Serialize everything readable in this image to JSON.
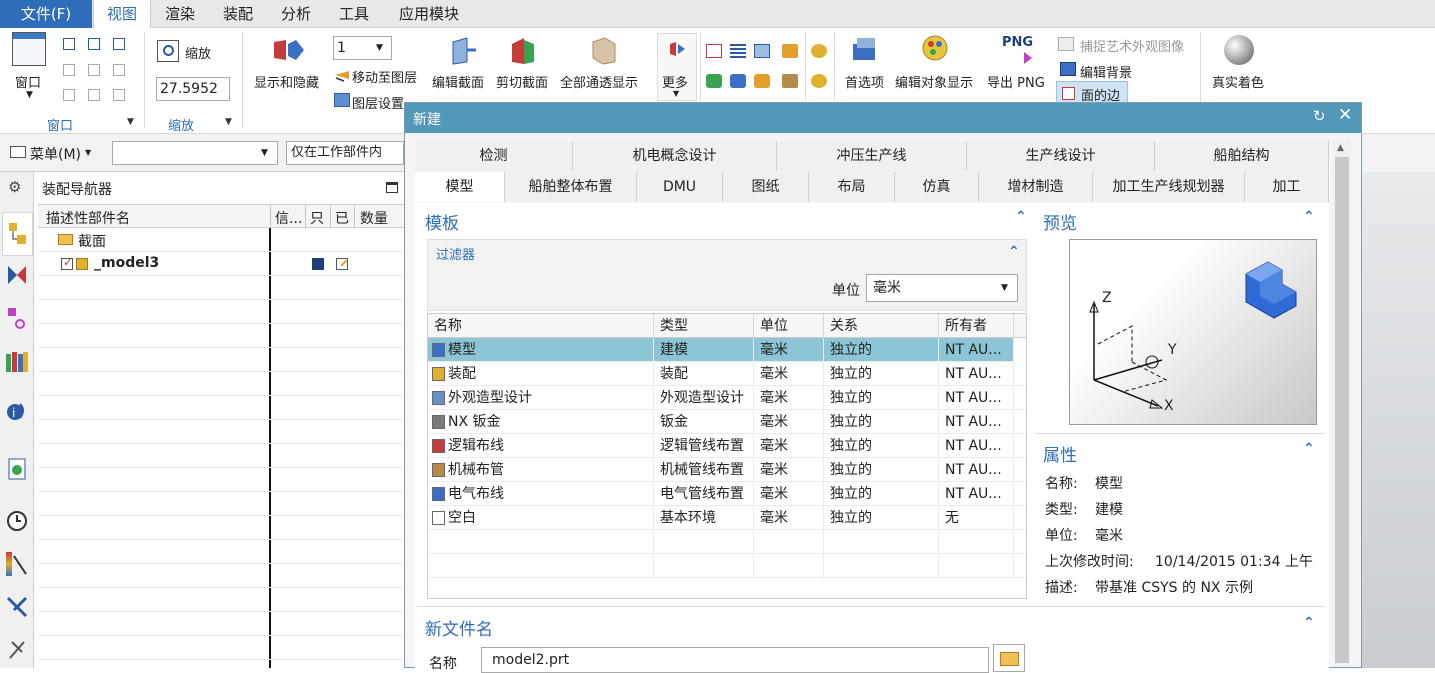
{
  "menubar": {
    "file": "文件(F)",
    "tabs": [
      "视图",
      "渲染",
      "装配",
      "分析",
      "工具",
      "应用模块"
    ],
    "active_tab": "视图"
  },
  "ribbon": {
    "window_label": "窗口",
    "group_window": "窗口",
    "zoom_label": "缩放",
    "zoom_value": "27.5952",
    "group_zoom": "缩放",
    "layer_value": "1",
    "show_hide": "显示和隐藏",
    "move_to_layer": "移动至图层",
    "layer_settings": "图层设置",
    "edit_section": "编辑截面",
    "clip_section": "剪切截面",
    "all_transparent": "全部通透显示",
    "more": "更多",
    "preferences": "首选项",
    "edit_object_display": "编辑对象显示",
    "export_png": "导出 PNG",
    "png_icon_text": "PNG",
    "capture_art": "捕捉艺术外观图像",
    "edit_background": "编辑背景",
    "face_edges": "面的边",
    "true_shading": "真实着色"
  },
  "bar2": {
    "menu": "菜单(M)",
    "filter_dropdown": "",
    "scope_dropdown": "仅在工作部件内"
  },
  "navigator": {
    "title": "装配导航器",
    "columns": [
      "描述性部件名",
      "信...",
      "只",
      "已",
      "数量"
    ],
    "items": [
      {
        "name": "截面"
      },
      {
        "name": "_model3"
      }
    ]
  },
  "dialog": {
    "title": "新建",
    "tabs_row1": [
      "检测",
      "机电概念设计",
      "冲压生产线",
      "生产线设计",
      "船舶结构"
    ],
    "tabs_row2": [
      "模型",
      "船舶整体布置",
      "DMU",
      "图纸",
      "布局",
      "仿真",
      "增材制造",
      "加工生产线规划器",
      "加工"
    ],
    "active_tab": "模型",
    "template_title": "模板",
    "filter_title": "过滤器",
    "unit_label": "单位",
    "unit_value": "毫米",
    "table_headers": [
      "名称",
      "类型",
      "单位",
      "关系",
      "所有者"
    ],
    "rows": [
      {
        "name": "模型",
        "type": "建模",
        "unit": "毫米",
        "relation": "独立的",
        "owner": "NT AU...",
        "icon": "model-icon"
      },
      {
        "name": "装配",
        "type": "装配",
        "unit": "毫米",
        "relation": "独立的",
        "owner": "NT AU...",
        "icon": "assembly-icon"
      },
      {
        "name": "外观造型设计",
        "type": "外观造型设计",
        "unit": "毫米",
        "relation": "独立的",
        "owner": "NT AU...",
        "icon": "shape-studio-icon"
      },
      {
        "name": "NX 钣金",
        "type": "钣金",
        "unit": "毫米",
        "relation": "独立的",
        "owner": "NT AU...",
        "icon": "sheet-metal-icon"
      },
      {
        "name": "逻辑布线",
        "type": "逻辑管线布置",
        "unit": "毫米",
        "relation": "独立的",
        "owner": "NT AU...",
        "icon": "logical-routing-icon"
      },
      {
        "name": "机械布管",
        "type": "机械管线布置",
        "unit": "毫米",
        "relation": "独立的",
        "owner": "NT AU...",
        "icon": "mechanical-routing-icon"
      },
      {
        "name": "电气布线",
        "type": "电气管线布置",
        "unit": "毫米",
        "relation": "独立的",
        "owner": "NT AU...",
        "icon": "electrical-routing-icon"
      },
      {
        "name": "空白",
        "type": "基本环境",
        "unit": "毫米",
        "relation": "独立的",
        "owner": "无",
        "icon": "blank-icon"
      }
    ],
    "selected_row": 0,
    "preview_title": "预览",
    "preview_axes": {
      "z": "Z",
      "y": "Y",
      "x": "X"
    },
    "properties_title": "属性",
    "properties": [
      {
        "label": "名称:",
        "value": "模型"
      },
      {
        "label": "类型:",
        "value": "建模"
      },
      {
        "label": "单位:",
        "value": "毫米"
      },
      {
        "label": "上次修改时间:",
        "value": "10/14/2015 01:34 上午"
      },
      {
        "label": "描述:",
        "value": "带基准 CSYS 的 NX 示例"
      }
    ],
    "new_file_title": "新文件名",
    "name_label": "名称",
    "name_value": "model2.prt"
  },
  "colors": {
    "accent": "#2e6db8",
    "dialog_title": "#5498b9",
    "selected_row": "#8cc6d6"
  }
}
